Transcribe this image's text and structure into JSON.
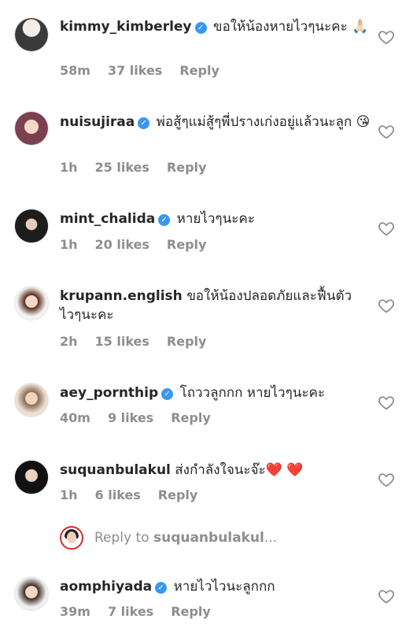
{
  "comments": [
    {
      "user": "kimmy_kimberley",
      "verified": true,
      "text": "ขอให้น้องหายไวๆนะคะ 🙏🏻",
      "time": "58m",
      "likes": "37 likes",
      "reply": "Reply"
    },
    {
      "user": "nuisujiraa",
      "verified": true,
      "text": "พ่อสู้ๆแม่สู้ๆพี่ปรางเก่งอยู่แล้วนะลูก 😘",
      "time": "1h",
      "likes": "25 likes",
      "reply": "Reply"
    },
    {
      "user": "mint_chalida",
      "verified": true,
      "text": "หายไวๆนะคะ",
      "time": "1h",
      "likes": "20 likes",
      "reply": "Reply"
    },
    {
      "user": "krupann.english",
      "verified": false,
      "text": "ขอให้น้องปลอดภัยและฟื้นตัวไวๆนะคะ",
      "time": "2h",
      "likes": "15 likes",
      "reply": "Reply"
    },
    {
      "user": "aey_pornthip",
      "verified": true,
      "text": "โถววลูกกก หายไวๆนะคะ",
      "time": "40m",
      "likes": "9 likes",
      "reply": "Reply"
    },
    {
      "user": "suquanbulakul",
      "verified": false,
      "text": "ส่งกำลังใจนะจ๊ะ❤️ ❤️",
      "time": "1h",
      "likes": "6 likes",
      "reply": "Reply"
    },
    {
      "user": "aomphiyada",
      "verified": true,
      "text": "หายไวไวนะลูกกก",
      "time": "39m",
      "likes": "7 likes",
      "reply": "Reply"
    }
  ],
  "reply_prompt": {
    "prefix": "Reply to ",
    "user": "suquanbulakul",
    "suffix": "..."
  },
  "colors": {
    "verified": "#3897f0",
    "meta": "#8e8e8e",
    "text": "#262626"
  }
}
